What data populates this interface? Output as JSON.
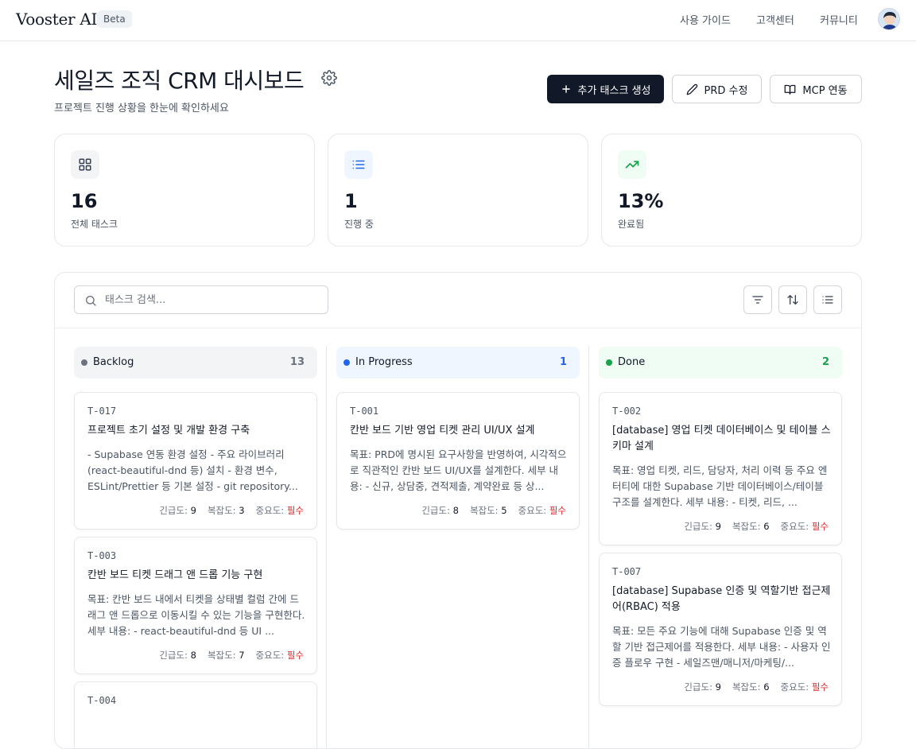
{
  "header": {
    "logo": "Vooster AI",
    "badge": "Beta",
    "nav": [
      "사용 가이드",
      "고객센터",
      "커뮤니티"
    ]
  },
  "page": {
    "title": "세일즈 조직 CRM 대시보드",
    "subtitle": "프로젝트 진행 상황을 한눈에 확인하세요",
    "buttons": {
      "create": "추가 태스크 생성",
      "prd": "PRD 수정",
      "mcp": "MCP 연동"
    }
  },
  "stats": [
    {
      "value": "16",
      "label": "전체 태스크",
      "icon": "grid-icon",
      "color": "#374151"
    },
    {
      "value": "1",
      "label": "진행 중",
      "icon": "list-icon",
      "color": "#2563eb"
    },
    {
      "value": "13%",
      "label": "완료됨",
      "icon": "trending-up-icon",
      "color": "#16a34a"
    }
  ],
  "board": {
    "search_placeholder": "태스크 검색...",
    "meta_labels": {
      "urgency": "긴급도:",
      "complexity": "복잡도:",
      "importance": "중요도:"
    },
    "columns": [
      {
        "name": "Backlog",
        "count": "13",
        "color": "#6b7280",
        "bg": "#f3f4f6",
        "cards": [
          {
            "id": "T-017",
            "title": "프로젝트 초기 설정 및 개발 환경 구축",
            "desc": "- Supabase 연동 환경 설정 - 주요 라이브러리 (react-beautiful-dnd 등) 설치 - 환경 변수, ESLint/Prettier 등 기본 설정 - git repository...",
            "urgency": "9",
            "complexity": "3",
            "importance": "필수"
          },
          {
            "id": "T-003",
            "title": "칸반 보드 티켓 드래그 앤 드롭 기능 구현",
            "desc": "목표: 칸반 보드 내에서 티켓을 상태별 컬럼 간에 드래그 앤 드롭으로 이동시킬 수 있는 기능을 구현한다. 세부 내용: - react-beautiful-dnd 등 UI ...",
            "urgency": "8",
            "complexity": "7",
            "importance": "필수"
          },
          {
            "id": "T-004",
            "title": "",
            "desc": "",
            "urgency": "",
            "complexity": "",
            "importance": ""
          }
        ]
      },
      {
        "name": "In Progress",
        "count": "1",
        "color": "#2563eb",
        "bg": "#eff6ff",
        "cards": [
          {
            "id": "T-001",
            "title": "칸반 보드 기반 영업 티켓 관리 UI/UX 설계",
            "desc": "목표: PRD에 명시된 요구사항을 반영하여, 시각적으로 직관적인 칸반 보드 UI/UX를 설계한다. 세부 내용: - 신규, 상담중, 견적제출, 계약완료 등 상...",
            "urgency": "8",
            "complexity": "5",
            "importance": "필수"
          }
        ]
      },
      {
        "name": "Done",
        "count": "2",
        "color": "#16a34a",
        "bg": "#f0fdf4",
        "cards": [
          {
            "id": "T-002",
            "title": "[database] 영업 티켓 데이터베이스 및 테이블 스키마 설계",
            "desc": "목표: 영업 티켓, 리드, 담당자, 처리 이력 등 주요 엔터티에 대한 Supabase 기반 데이터베이스/테이블 구조를 설계한다. 세부 내용: - 티켓, 리드, ...",
            "urgency": "9",
            "complexity": "6",
            "importance": "필수"
          },
          {
            "id": "T-007",
            "title": "[database] Supabase 인증 및 역할기반 접근제어(RBAC) 적용",
            "desc": "목표: 모든 주요 기능에 대해 Supabase 인증 및 역할 기반 접근제어를 적용한다. 세부 내용: - 사용자 인증 플로우 구현 - 세일즈맨/매니저/마케팅/...",
            "urgency": "9",
            "complexity": "6",
            "importance": "필수"
          }
        ]
      }
    ]
  }
}
